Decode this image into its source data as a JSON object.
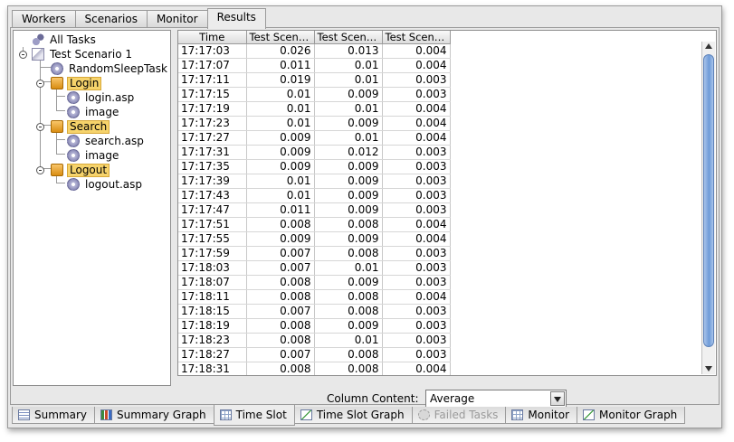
{
  "top_tabs": [
    "Workers",
    "Scenarios",
    "Monitor",
    "Results"
  ],
  "active_top_tab": "Results",
  "tree": {
    "root": "All Tasks",
    "scenario": "Test Scenario 1",
    "task": "RandomSleepTask",
    "groups": [
      {
        "label": "Login",
        "children": [
          "login.asp",
          "image"
        ]
      },
      {
        "label": "Search",
        "children": [
          "search.asp",
          "image"
        ]
      },
      {
        "label": "Logout",
        "children": [
          "logout.asp"
        ]
      }
    ]
  },
  "table": {
    "headers": [
      "Time",
      "Test Scena...",
      "Test Scena...",
      "Test Scena..."
    ],
    "rows": [
      [
        "17:17:03",
        "0.026",
        "0.013",
        "0.004"
      ],
      [
        "17:17:07",
        "0.011",
        "0.01",
        "0.004"
      ],
      [
        "17:17:11",
        "0.019",
        "0.01",
        "0.003"
      ],
      [
        "17:17:15",
        "0.01",
        "0.009",
        "0.003"
      ],
      [
        "17:17:19",
        "0.01",
        "0.01",
        "0.004"
      ],
      [
        "17:17:23",
        "0.01",
        "0.009",
        "0.004"
      ],
      [
        "17:17:27",
        "0.009",
        "0.01",
        "0.004"
      ],
      [
        "17:17:31",
        "0.009",
        "0.012",
        "0.003"
      ],
      [
        "17:17:35",
        "0.009",
        "0.009",
        "0.003"
      ],
      [
        "17:17:39",
        "0.01",
        "0.009",
        "0.003"
      ],
      [
        "17:17:43",
        "0.01",
        "0.009",
        "0.003"
      ],
      [
        "17:17:47",
        "0.011",
        "0.009",
        "0.003"
      ],
      [
        "17:17:51",
        "0.008",
        "0.008",
        "0.004"
      ],
      [
        "17:17:55",
        "0.009",
        "0.009",
        "0.004"
      ],
      [
        "17:17:59",
        "0.007",
        "0.008",
        "0.003"
      ],
      [
        "17:18:03",
        "0.007",
        "0.01",
        "0.003"
      ],
      [
        "17:18:07",
        "0.008",
        "0.009",
        "0.003"
      ],
      [
        "17:18:11",
        "0.008",
        "0.008",
        "0.004"
      ],
      [
        "17:18:15",
        "0.007",
        "0.008",
        "0.003"
      ],
      [
        "17:18:19",
        "0.008",
        "0.009",
        "0.003"
      ],
      [
        "17:18:23",
        "0.008",
        "0.01",
        "0.003"
      ],
      [
        "17:18:27",
        "0.007",
        "0.008",
        "0.003"
      ],
      [
        "17:18:31",
        "0.008",
        "0.008",
        "0.004"
      ]
    ]
  },
  "column_content": {
    "label": "Column Content:",
    "value": "Average"
  },
  "bottom_tabs": [
    {
      "label": "Summary",
      "icon": "summary-icon",
      "state": "normal"
    },
    {
      "label": "Summary Graph",
      "icon": "bar-chart-icon",
      "state": "normal"
    },
    {
      "label": "Time Slot",
      "icon": "grid-icon",
      "state": "active"
    },
    {
      "label": "Time Slot Graph",
      "icon": "line-chart-icon",
      "state": "normal"
    },
    {
      "label": "Failed Tasks",
      "icon": "gear-icon",
      "state": "disabled"
    },
    {
      "label": "Monitor",
      "icon": "grid-icon",
      "state": "normal"
    },
    {
      "label": "Monitor Graph",
      "icon": "line-chart-icon",
      "state": "normal"
    }
  ]
}
